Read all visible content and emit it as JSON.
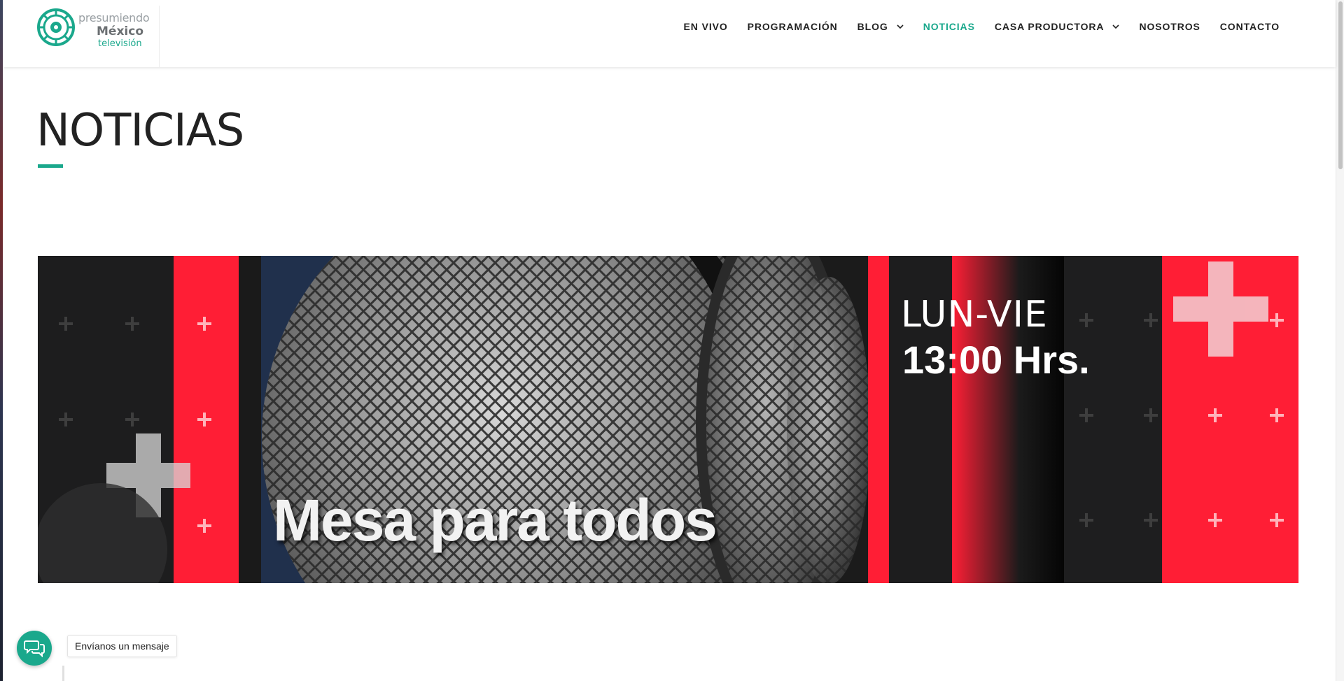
{
  "logo": {
    "line1": "presumiendo",
    "line2": "México",
    "line3": "televisión"
  },
  "nav": {
    "items": [
      {
        "label": "EN VIVO"
      },
      {
        "label": "PROGRAMACIÓN"
      },
      {
        "label": "BLOG"
      },
      {
        "label": "NOTICIAS"
      },
      {
        "label": "CASA PRODUCTORA"
      },
      {
        "label": "NOSOTROS"
      },
      {
        "label": "CONTACTO"
      }
    ]
  },
  "page": {
    "title": "NOTICIAS"
  },
  "banner": {
    "title": "Mesa para todos",
    "days": "LUN-VIE",
    "time": "13:00 Hrs."
  },
  "chat": {
    "label": "Envíanos un mensaje"
  },
  "colors": {
    "accent": "#1aa88c",
    "banner_red": "#ff1e35",
    "banner_dark": "#1c1c1d"
  }
}
